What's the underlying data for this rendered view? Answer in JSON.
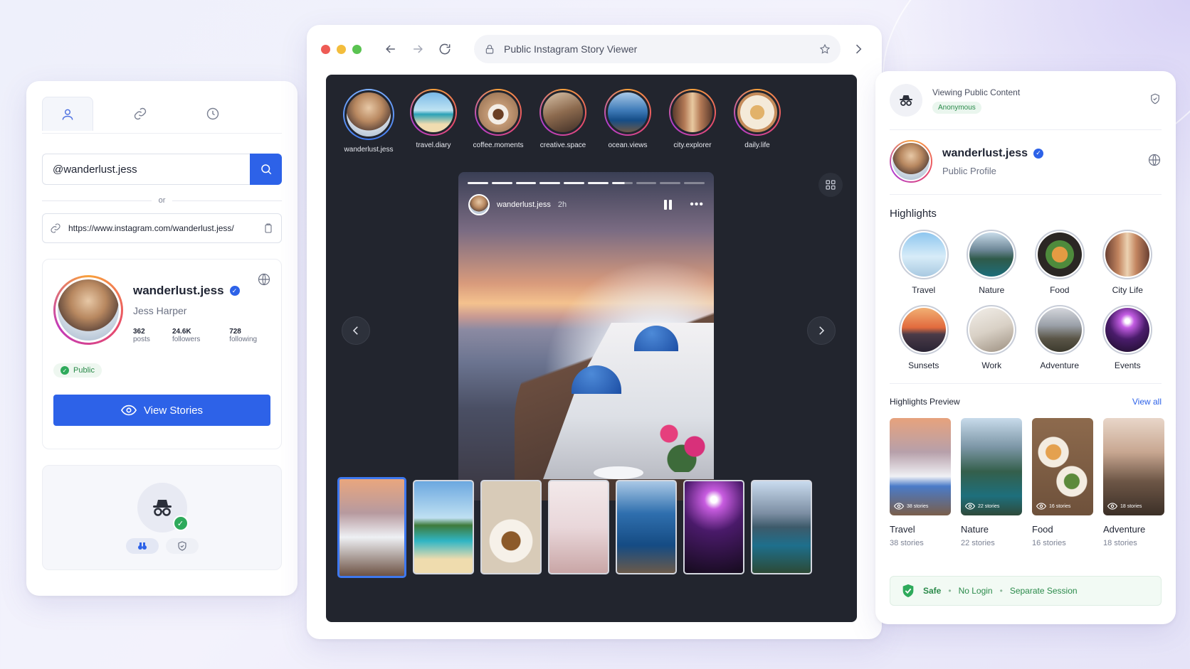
{
  "left_panel": {
    "tabs": [
      {
        "name": "tab-username",
        "icon": "user-icon",
        "active": true
      },
      {
        "name": "tab-link",
        "icon": "link-icon",
        "active": false
      },
      {
        "name": "tab-history",
        "icon": "clock-icon",
        "active": false
      }
    ],
    "search_value": "@wanderlust.jess",
    "or_text": "or",
    "url_value": "https://www.instagram.com/wanderlust.jess/",
    "profile": {
      "username": "wanderlust.jess",
      "full_name": "Jess Harper",
      "posts_count": "362",
      "posts_label": "posts",
      "followers_count": "24.6K",
      "followers_label": "followers",
      "following_count": "728",
      "following_label": "following",
      "visibility": "Public"
    },
    "view_button": "View Stories"
  },
  "browser": {
    "address_text": "Public Instagram Story Viewer",
    "stories": [
      {
        "label": "wanderlust.jess",
        "active": true
      },
      {
        "label": "travel.diary"
      },
      {
        "label": "coffee.moments"
      },
      {
        "label": "creative.space"
      },
      {
        "label": "ocean.views"
      },
      {
        "label": "city.explorer"
      },
      {
        "label": "daily.life"
      }
    ],
    "frame": {
      "username": "wanderlust.jess",
      "time": "2h",
      "progress_segments_total": 10,
      "progress_segments_done": 6
    }
  },
  "right_panel": {
    "viewing_title": "Viewing Public Content",
    "anonymous_badge": "Anonymous",
    "username": "wanderlust.jess",
    "profile_sub": "Public Profile",
    "highlights_title": "Highlights",
    "highlights": [
      {
        "label": "Travel"
      },
      {
        "label": "Nature"
      },
      {
        "label": "Food"
      },
      {
        "label": "City Life"
      },
      {
        "label": "Sunsets"
      },
      {
        "label": "Work"
      },
      {
        "label": "Adventure"
      },
      {
        "label": "Events"
      }
    ],
    "preview_title": "Highlights Preview",
    "view_all": "View all",
    "previews": [
      {
        "name": "Travel",
        "count_overlay": "38 stories",
        "sub": "38 stories"
      },
      {
        "name": "Nature",
        "count_overlay": "22 stories",
        "sub": "22 stories"
      },
      {
        "name": "Food",
        "count_overlay": "16 stories",
        "sub": "16 stories"
      },
      {
        "name": "Adventure",
        "count_overlay": "18 stories",
        "sub": "18 stories"
      }
    ],
    "safe_bar": {
      "safe": "Safe",
      "no_login": "No Login",
      "session": "Separate Session",
      "separator": "•"
    }
  },
  "colors": {
    "accent": "#2d62e8",
    "success": "#2eaa5b",
    "viewer_bg": "#22252e"
  }
}
